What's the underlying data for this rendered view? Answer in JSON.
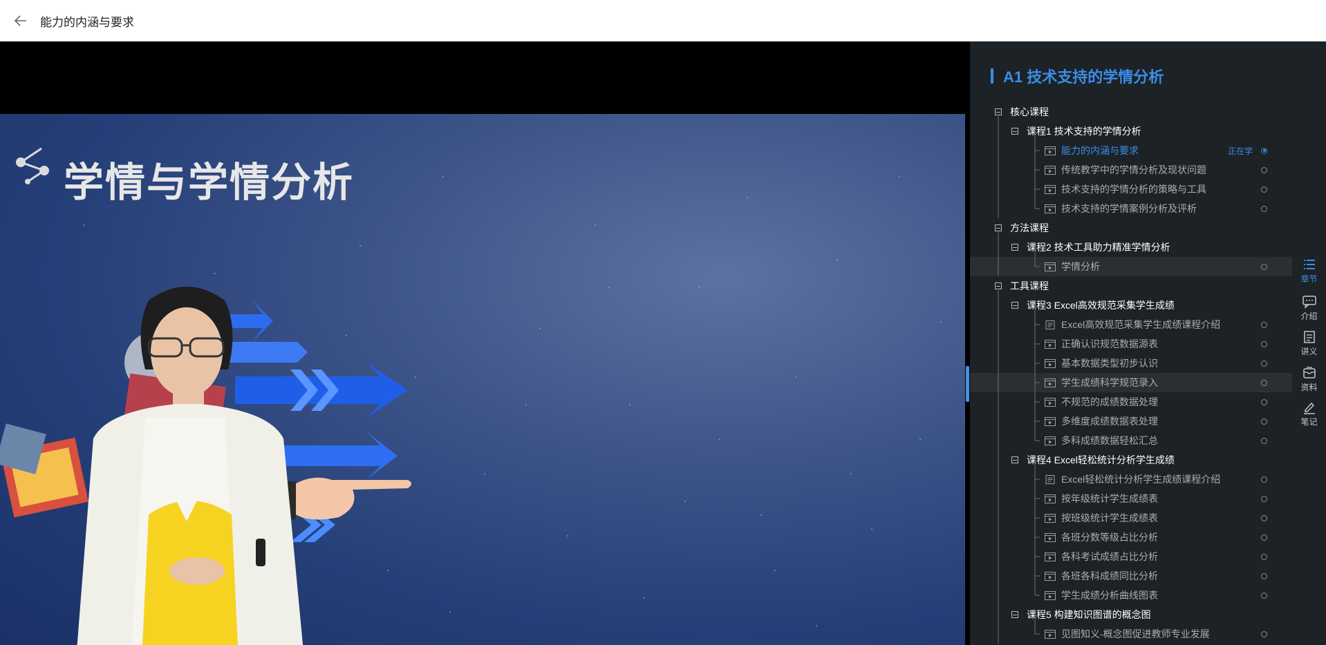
{
  "header": {
    "title": "能力的内涵与要求"
  },
  "video": {
    "slide_title": "学情与学情分析"
  },
  "panel": {
    "course_title": "A1 技术支持的学情分析",
    "learning_tag": "正在学",
    "groups": [
      {
        "label": "核心课程",
        "courses": [
          {
            "label": "课程1 技术支持的学情分析",
            "lessons": [
              {
                "label": "能力的内涵与要求",
                "type": "video",
                "active": true
              },
              {
                "label": "传统教学中的学情分析及现状问题",
                "type": "video"
              },
              {
                "label": "技术支持的学情分析的策略与工具",
                "type": "video"
              },
              {
                "label": "技术支持的学情案例分析及评析",
                "type": "video"
              }
            ]
          }
        ]
      },
      {
        "label": "方法课程",
        "courses": [
          {
            "label": "课程2 技术工具助力精准学情分析",
            "lessons": [
              {
                "label": "学情分析",
                "type": "video",
                "hover": true
              }
            ]
          }
        ]
      },
      {
        "label": "工具课程",
        "courses": [
          {
            "label": "课程3 Excel高效规范采集学生成绩",
            "lessons": [
              {
                "label": "Excel高效规范采集学生成绩课程介绍",
                "type": "doc"
              },
              {
                "label": "正确认识规范数据源表",
                "type": "video"
              },
              {
                "label": "基本数据类型初步认识",
                "type": "video"
              },
              {
                "label": "学生成绩科学规范录入",
                "type": "video",
                "hover": true
              },
              {
                "label": "不规范的成绩数据处理",
                "type": "video"
              },
              {
                "label": "多维度成绩数据表处理",
                "type": "video"
              },
              {
                "label": "多科成绩数据轻松汇总",
                "type": "video"
              }
            ]
          },
          {
            "label": "课程4 Excel轻松统计分析学生成绩",
            "lessons": [
              {
                "label": "Excel轻松统计分析学生成绩课程介绍",
                "type": "doc"
              },
              {
                "label": "按年级统计学生成绩表",
                "type": "video"
              },
              {
                "label": "按班级统计学生成绩表",
                "type": "video"
              },
              {
                "label": "各班分数等级占比分析",
                "type": "video"
              },
              {
                "label": "各科考试成绩占比分析",
                "type": "video"
              },
              {
                "label": "各班各科成绩同比分析",
                "type": "video"
              },
              {
                "label": "学生成绩分析曲线图表",
                "type": "video"
              }
            ]
          },
          {
            "label": "课程5 构建知识图谱的概念图",
            "lessons": [
              {
                "label": "见图知义-概念图促进教师专业发展",
                "type": "video"
              }
            ]
          }
        ]
      }
    ]
  },
  "rail": {
    "items": [
      {
        "label": "章节",
        "icon": "chapter-list-icon",
        "active": true
      },
      {
        "label": "介绍",
        "icon": "intro-chat-icon"
      },
      {
        "label": "讲义",
        "icon": "handout-doc-icon"
      },
      {
        "label": "资料",
        "icon": "materials-icon"
      },
      {
        "label": "笔记",
        "icon": "note-pen-icon"
      }
    ]
  },
  "colors": {
    "accent": "#3a8ee6",
    "panel_bg": "#1d2226"
  }
}
